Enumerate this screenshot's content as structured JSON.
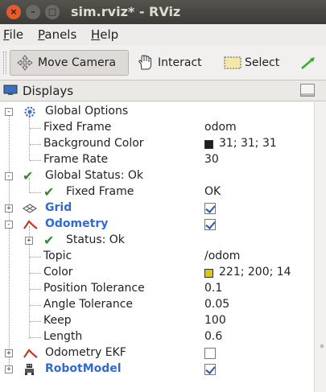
{
  "window": {
    "title": "sim.rviz* - RViz",
    "buttons": {
      "close": "×",
      "minimize": "–",
      "maximize": "□"
    }
  },
  "menubar": {
    "items": [
      {
        "label": "File",
        "mnemonic": "F"
      },
      {
        "label": "Panels",
        "mnemonic": "P"
      },
      {
        "label": "Help",
        "mnemonic": "H"
      }
    ]
  },
  "toolbar": {
    "tools": [
      {
        "label": "Move Camera",
        "icon": "move-camera-icon",
        "active": true
      },
      {
        "label": "Interact",
        "icon": "hand-icon",
        "active": false
      },
      {
        "label": "Select",
        "icon": "select-box-icon",
        "active": false
      },
      {
        "label": "",
        "icon": "focus-arrow-icon",
        "active": false
      }
    ]
  },
  "displays_panel": {
    "title": "Displays",
    "rows": [
      {
        "label": "Global Options",
        "value": "",
        "icon": "gear-icon",
        "expander": "-"
      },
      {
        "label": "Fixed Frame",
        "value": "odom"
      },
      {
        "label": "Background Color",
        "value": "31; 31; 31",
        "swatch": "#1f1f1f"
      },
      {
        "label": "Frame Rate",
        "value": "30"
      },
      {
        "label": "Global Status: Ok",
        "value": "",
        "icon": "check-icon",
        "expander": "-"
      },
      {
        "label": "Fixed Frame",
        "value": "OK",
        "icon": "check-icon"
      },
      {
        "label": "Grid",
        "checked": true,
        "icon": "grid-icon",
        "expander": "+"
      },
      {
        "label": "Odometry",
        "checked": true,
        "icon": "odometry-icon",
        "expander": "-"
      },
      {
        "label": "Status: Ok",
        "value": "",
        "icon": "check-icon",
        "expander": "+"
      },
      {
        "label": "Topic",
        "value": "/odom"
      },
      {
        "label": "Color",
        "value": "221; 200; 14",
        "swatch": "#ddc80e"
      },
      {
        "label": "Position Tolerance",
        "value": "0.1"
      },
      {
        "label": "Angle Tolerance",
        "value": "0.05"
      },
      {
        "label": "Keep",
        "value": "100"
      },
      {
        "label": "Length",
        "value": "0.6"
      },
      {
        "label": "Odometry EKF",
        "checked": false,
        "icon": "odometry-icon",
        "expander": "+"
      },
      {
        "label": "RobotModel",
        "checked": true,
        "icon": "robot-model-icon",
        "expander": "+"
      }
    ]
  },
  "colors": {
    "titlebar": "#3d3b37",
    "close_button": "#e55b2c",
    "link_blue": "#2f6bd1",
    "check_green": "#2e8b2e"
  }
}
